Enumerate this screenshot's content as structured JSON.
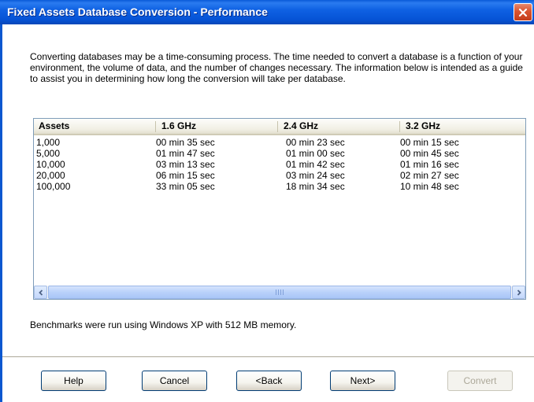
{
  "window": {
    "title": "Fixed Assets Database Conversion - Performance"
  },
  "intro_text": "Converting databases may be a time-consuming process. The time needed to convert a database is a function of your environment, the volume of data, and the number of changes necessary. The information below is intended as a guide to assist you in determining how long the conversion will take per database.",
  "table": {
    "columns": [
      "Assets",
      "1.6 GHz",
      "2.4 GHz",
      "3.2 GHz"
    ],
    "rows": [
      [
        "1,000",
        "00 min 35 sec",
        "00 min 23 sec",
        "00 min 15 sec"
      ],
      [
        "5,000",
        "01 min 47 sec",
        "01 min 00 sec",
        "00 min 45 sec"
      ],
      [
        "10,000",
        "03 min 13 sec",
        "01 min 42 sec",
        "01 min 16 sec"
      ],
      [
        "20,000",
        "06 min 15 sec",
        "03 min 24 sec",
        "02 min 27 sec"
      ],
      [
        "100,000",
        "33 min 05 sec",
        "18 min 34 sec",
        "10 min 48 sec"
      ]
    ]
  },
  "benchmark_note": "Benchmarks were run using Windows XP with 512 MB memory.",
  "buttons": {
    "help": "Help",
    "cancel": "Cancel",
    "back": "<Back",
    "next": "Next>",
    "convert": "Convert"
  },
  "icons": {
    "close": "close-icon",
    "scroll_left": "scroll-left-icon",
    "scroll_right": "scroll-right-icon"
  },
  "colors": {
    "titlebar": "#0653d6",
    "close_button": "#d9532f",
    "dialog_background": "#ffffff"
  }
}
